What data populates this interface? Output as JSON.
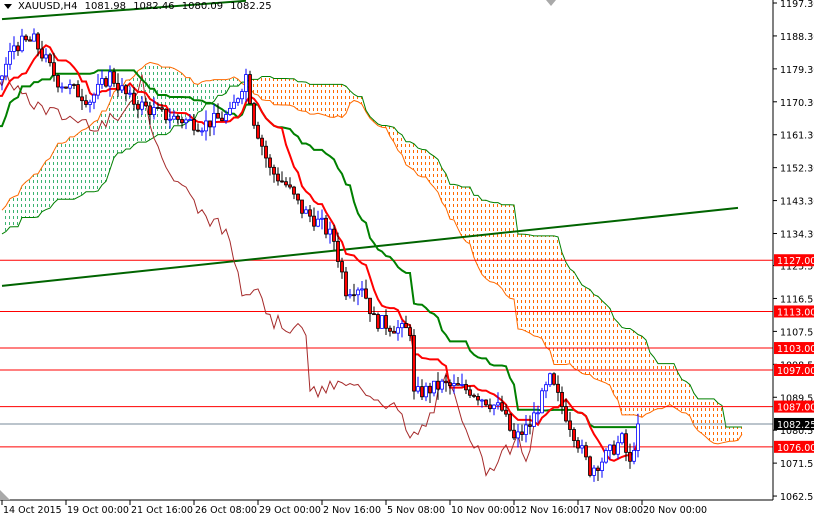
{
  "header": {
    "symbol": "XAUUSD,H4",
    "open": "1081.98",
    "high": "1082.46",
    "low": "1080.09",
    "close": "1082.25"
  },
  "colors": {
    "bull_outline": "#0000ff",
    "bear_body": "#ff0000",
    "tenkan": "#ff0000",
    "kijun": "#008000",
    "chikou": "#a52a2a",
    "cloud_bull": "#3cb371",
    "cloud_bear": "#ff6a00",
    "level_line": "#ff0000",
    "trendline": "#006400",
    "price_line": "#778899"
  },
  "chart_data": {
    "type": "candlestick",
    "symbol": "XAUUSD",
    "timeframe": "H4",
    "indicator": "Ichimoku Kinko Hyo (9,26,52)",
    "price_axis": {
      "range": [
        1062.55,
        1197.3
      ],
      "ticks": [
        "1197.30",
        "1188.30",
        "1179.30",
        "1170.30",
        "1161.30",
        "1152.30",
        "1143.30",
        "1134.30",
        "1125.55",
        "1116.55",
        "1107.55",
        "1098.55",
        "1089.55",
        "1080.55",
        "1071.55",
        "1062.55"
      ]
    },
    "time_axis": {
      "bars_per_label": 16,
      "labels": [
        "14 Oct 2015",
        "19 Oct 00:00",
        "21 Oct 16:00",
        "26 Oct 08:00",
        "29 Oct 00:00",
        "2 Nov 16:00",
        "5 Nov 08:00",
        "10 Nov 00:00",
        "12 Nov 16:00",
        "17 Nov 08:00",
        "20 Nov 00:00"
      ]
    },
    "close_keypoints": [
      [
        -60,
        1118
      ],
      [
        -52,
        1122
      ],
      [
        -40,
        1132
      ],
      [
        -30,
        1145
      ],
      [
        -20,
        1160
      ],
      [
        -10,
        1172
      ],
      [
        -3,
        1168
      ],
      [
        0,
        1177.6
      ],
      [
        3,
        1185.8
      ],
      [
        8,
        1187
      ],
      [
        14,
        1176
      ],
      [
        22,
        1170.8
      ],
      [
        27,
        1177.6
      ],
      [
        32,
        1170.8
      ],
      [
        40,
        1166.7
      ],
      [
        50,
        1164
      ],
      [
        57,
        1166.7
      ],
      [
        61,
        1177.6
      ],
      [
        63,
        1165.3
      ],
      [
        67,
        1151.7
      ],
      [
        71,
        1147.6
      ],
      [
        75,
        1140.7
      ],
      [
        80,
        1136.6
      ],
      [
        83,
        1132.5
      ],
      [
        86,
        1118.9
      ],
      [
        90,
        1120.2
      ],
      [
        93,
        1110.7
      ],
      [
        100,
        1107.9
      ],
      [
        102,
        1107.9
      ],
      [
        103,
        1090.2
      ],
      [
        110,
        1092.9
      ],
      [
        117,
        1091.5
      ],
      [
        125,
        1086
      ],
      [
        128,
        1077.9
      ],
      [
        132,
        1082
      ],
      [
        137,
        1094.3
      ],
      [
        141,
        1084.7
      ],
      [
        147,
        1069.7
      ],
      [
        150,
        1072.4
      ],
      [
        155,
        1077.9
      ],
      [
        157,
        1071
      ],
      [
        159,
        1082.25
      ]
    ],
    "horizontal_levels": [
      {
        "price": 1127.0,
        "label": "1127.00"
      },
      {
        "price": 1113.0,
        "label": "1113.00"
      },
      {
        "price": 1103.0,
        "label": "1103.00"
      },
      {
        "price": 1097.0,
        "label": "1097.00"
      },
      {
        "price": 1087.0,
        "label": "1087.00"
      },
      {
        "price": 1076.0,
        "label": "1076.00"
      }
    ],
    "current_price": {
      "price": 1082.25,
      "label": "1082.25"
    },
    "trendlines": [
      {
        "from": [
          0,
          1120.0
        ],
        "to": [
          184,
          1141.3
        ]
      },
      {
        "from": [
          0,
          1192.9
        ],
        "to": [
          61,
          1197.9
        ]
      }
    ]
  }
}
